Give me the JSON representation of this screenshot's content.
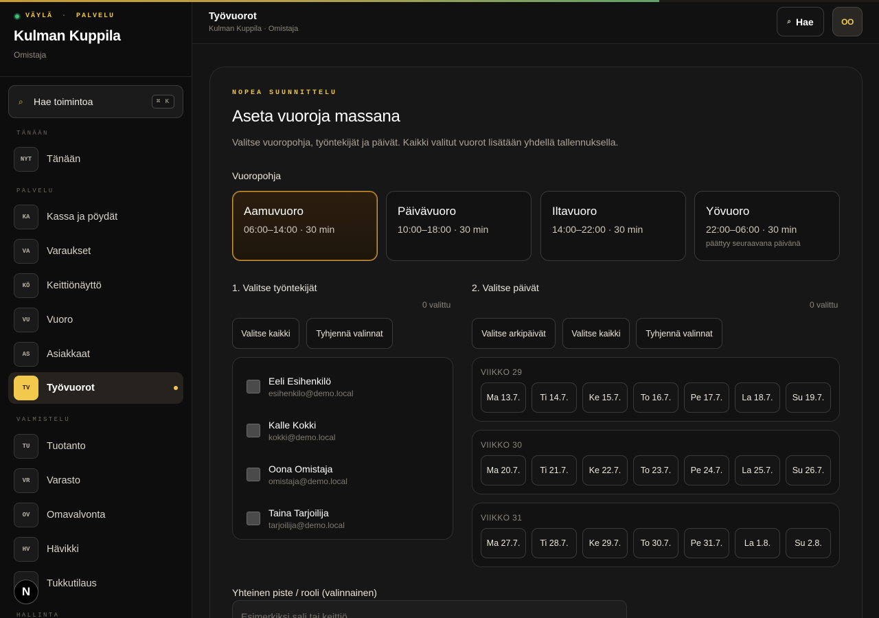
{
  "progress": {
    "percent": 75,
    "colors": [
      "#c99a2e",
      "#5fa06a"
    ]
  },
  "brand": {
    "label_left": "VÄYLÄ",
    "label_sep": "·",
    "label_right": "PALVELU",
    "name": "Kulman Kuppila",
    "role": "Omistaja",
    "status_color": "#3fbf76"
  },
  "sidebar": {
    "search": {
      "label": "Hae toimintoa",
      "shortcut": "⌘ K",
      "icon": "search-icon"
    },
    "sections": [
      "TÄNÄÄN",
      "PALVELU",
      "VALMISTELU",
      "HALLINTA"
    ],
    "items": [
      {
        "badge": "NYT",
        "label": "Tänään"
      },
      {
        "badge": "KA",
        "label": "Kassa ja pöydät"
      },
      {
        "badge": "VA",
        "label": "Varaukset"
      },
      {
        "badge": "KÖ",
        "label": "Keittiönäyttö"
      },
      {
        "badge": "VU",
        "label": "Vuoro"
      },
      {
        "badge": "AS",
        "label": "Asiakkaat"
      },
      {
        "badge": "TV",
        "label": "Työvuorot",
        "active": true
      },
      {
        "badge": "TU",
        "label": "Tuotanto"
      },
      {
        "badge": "VR",
        "label": "Varasto"
      },
      {
        "badge": "OV",
        "label": "Omavalvonta"
      },
      {
        "badge": "HV",
        "label": "Hävikki"
      },
      {
        "badge": "",
        "label": "Tukkutilaus"
      }
    ],
    "floating_badge": "N"
  },
  "header": {
    "title": "Työvuorot",
    "subtitle": "Kulman Kuppila · Omistaja",
    "search_label": "Hae",
    "avatar": "OO",
    "accent": "#f2c94c"
  },
  "main": {
    "eyebrow": "NOPEA SUUNNITTELU",
    "title": "Aseta vuoroja massana",
    "description": "Valitse vuoropohja, työntekijät ja päivät. Kaikki valitut vuorot lisätään yhdellä tallennuksella.",
    "template_label": "Vuoropohja",
    "templates": [
      {
        "name": "Aamuvuoro",
        "time": "06:00–14:00 · 30 min",
        "note": "",
        "selected": true
      },
      {
        "name": "Päivävuoro",
        "time": "10:00–18:00 · 30 min",
        "note": ""
      },
      {
        "name": "Iltavuoro",
        "time": "14:00–22:00 · 30 min",
        "note": ""
      },
      {
        "name": "Yövuoro",
        "time": "22:00–06:00 · 30 min",
        "note": "päättyy seuraavana päivänä"
      }
    ],
    "employees": {
      "title": "1. Valitse työntekijät",
      "count": "0 valittu",
      "select_all": "Valitse kaikki",
      "clear": "Tyhjennä valinnat",
      "list": [
        {
          "name": "Eeli Esihenkilö",
          "email": "esihenkilo@demo.local",
          "checked": false
        },
        {
          "name": "Kalle Kokki",
          "email": "kokki@demo.local",
          "checked": false
        },
        {
          "name": "Oona Omistaja",
          "email": "omistaja@demo.local",
          "checked": false
        },
        {
          "name": "Taina Tarjoilija",
          "email": "tarjoilija@demo.local",
          "checked": false
        }
      ]
    },
    "days": {
      "title": "2. Valitse päivät",
      "count": "0 valittu",
      "weekdays_btn": "Valitse arkipäivät",
      "select_all": "Valitse kaikki",
      "clear": "Tyhjennä valinnat",
      "weeks": [
        {
          "label": "VIIKKO 29",
          "days": [
            "Ma 13.7.",
            "Ti 14.7.",
            "Ke 15.7.",
            "To 16.7.",
            "Pe 17.7.",
            "La 18.7.",
            "Su 19.7."
          ]
        },
        {
          "label": "VIIKKO 30",
          "days": [
            "Ma 20.7.",
            "Ti 21.7.",
            "Ke 22.7.",
            "To 23.7.",
            "Pe 24.7.",
            "La 25.7.",
            "Su 26.7."
          ]
        },
        {
          "label": "VIIKKO 31",
          "days": [
            "Ma 27.7.",
            "Ti 28.7.",
            "Ke 29.7.",
            "To 30.7.",
            "Pe 31.7.",
            "La 1.8.",
            "Su 2.8."
          ]
        }
      ]
    },
    "shared": {
      "label": "Yhteinen piste / rooli (valinnainen)",
      "placeholder": "Esimerkiksi sali tai keittiö"
    }
  }
}
